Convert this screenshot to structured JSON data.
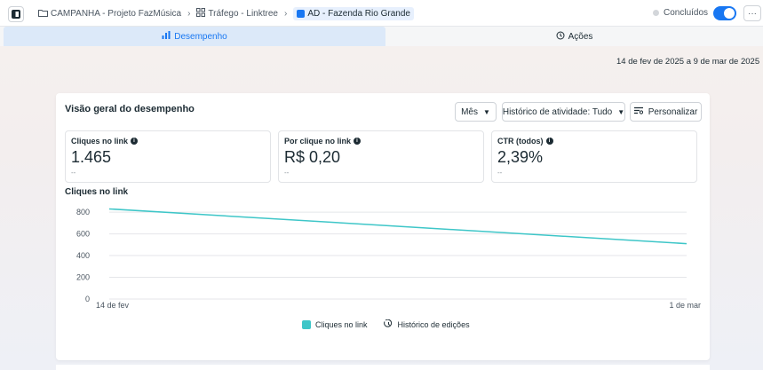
{
  "breadcrumb": {
    "campaign": "CAMPANHA - Projeto FazMúsica",
    "adset": "Tráfego - Linktree",
    "ad": "AD - Fazenda Rio Grande"
  },
  "status": {
    "label": "Concluídos",
    "toggle_on": true
  },
  "more_label": "···",
  "tabs": [
    {
      "label": "Desempenho",
      "active": true
    },
    {
      "label": "Ações",
      "active": false
    }
  ],
  "date_range": "14 de fev de 2025 a 9 de mar de 2025",
  "overview": {
    "title": "Visão geral do desempenho",
    "period_select": "Mês",
    "history_select": "Histórico de atividade: Tudo",
    "customize_label": "Personalizar"
  },
  "metrics": [
    {
      "label": "Cliques no link",
      "value": "1.465",
      "sub": "--"
    },
    {
      "label": "Por clique no link",
      "value": "R$ 0,20",
      "sub": "--"
    },
    {
      "label": "CTR (todos)",
      "value": "2,39%",
      "sub": "--"
    }
  ],
  "chart_data": {
    "type": "line",
    "title": "Cliques no link",
    "x_labels": [
      "14 de fev",
      "1 de mar"
    ],
    "series": [
      {
        "name": "Cliques no link",
        "values": [
          830,
          510
        ],
        "color": "#3ec6c8"
      }
    ],
    "y_ticks": [
      0,
      200,
      400,
      600,
      800
    ],
    "ylim": [
      0,
      850
    ],
    "grid": true,
    "legend": [
      "Cliques no link",
      "Histórico de edições"
    ]
  },
  "colors": {
    "accent": "#1877f2",
    "series": "#3ec6c8"
  }
}
